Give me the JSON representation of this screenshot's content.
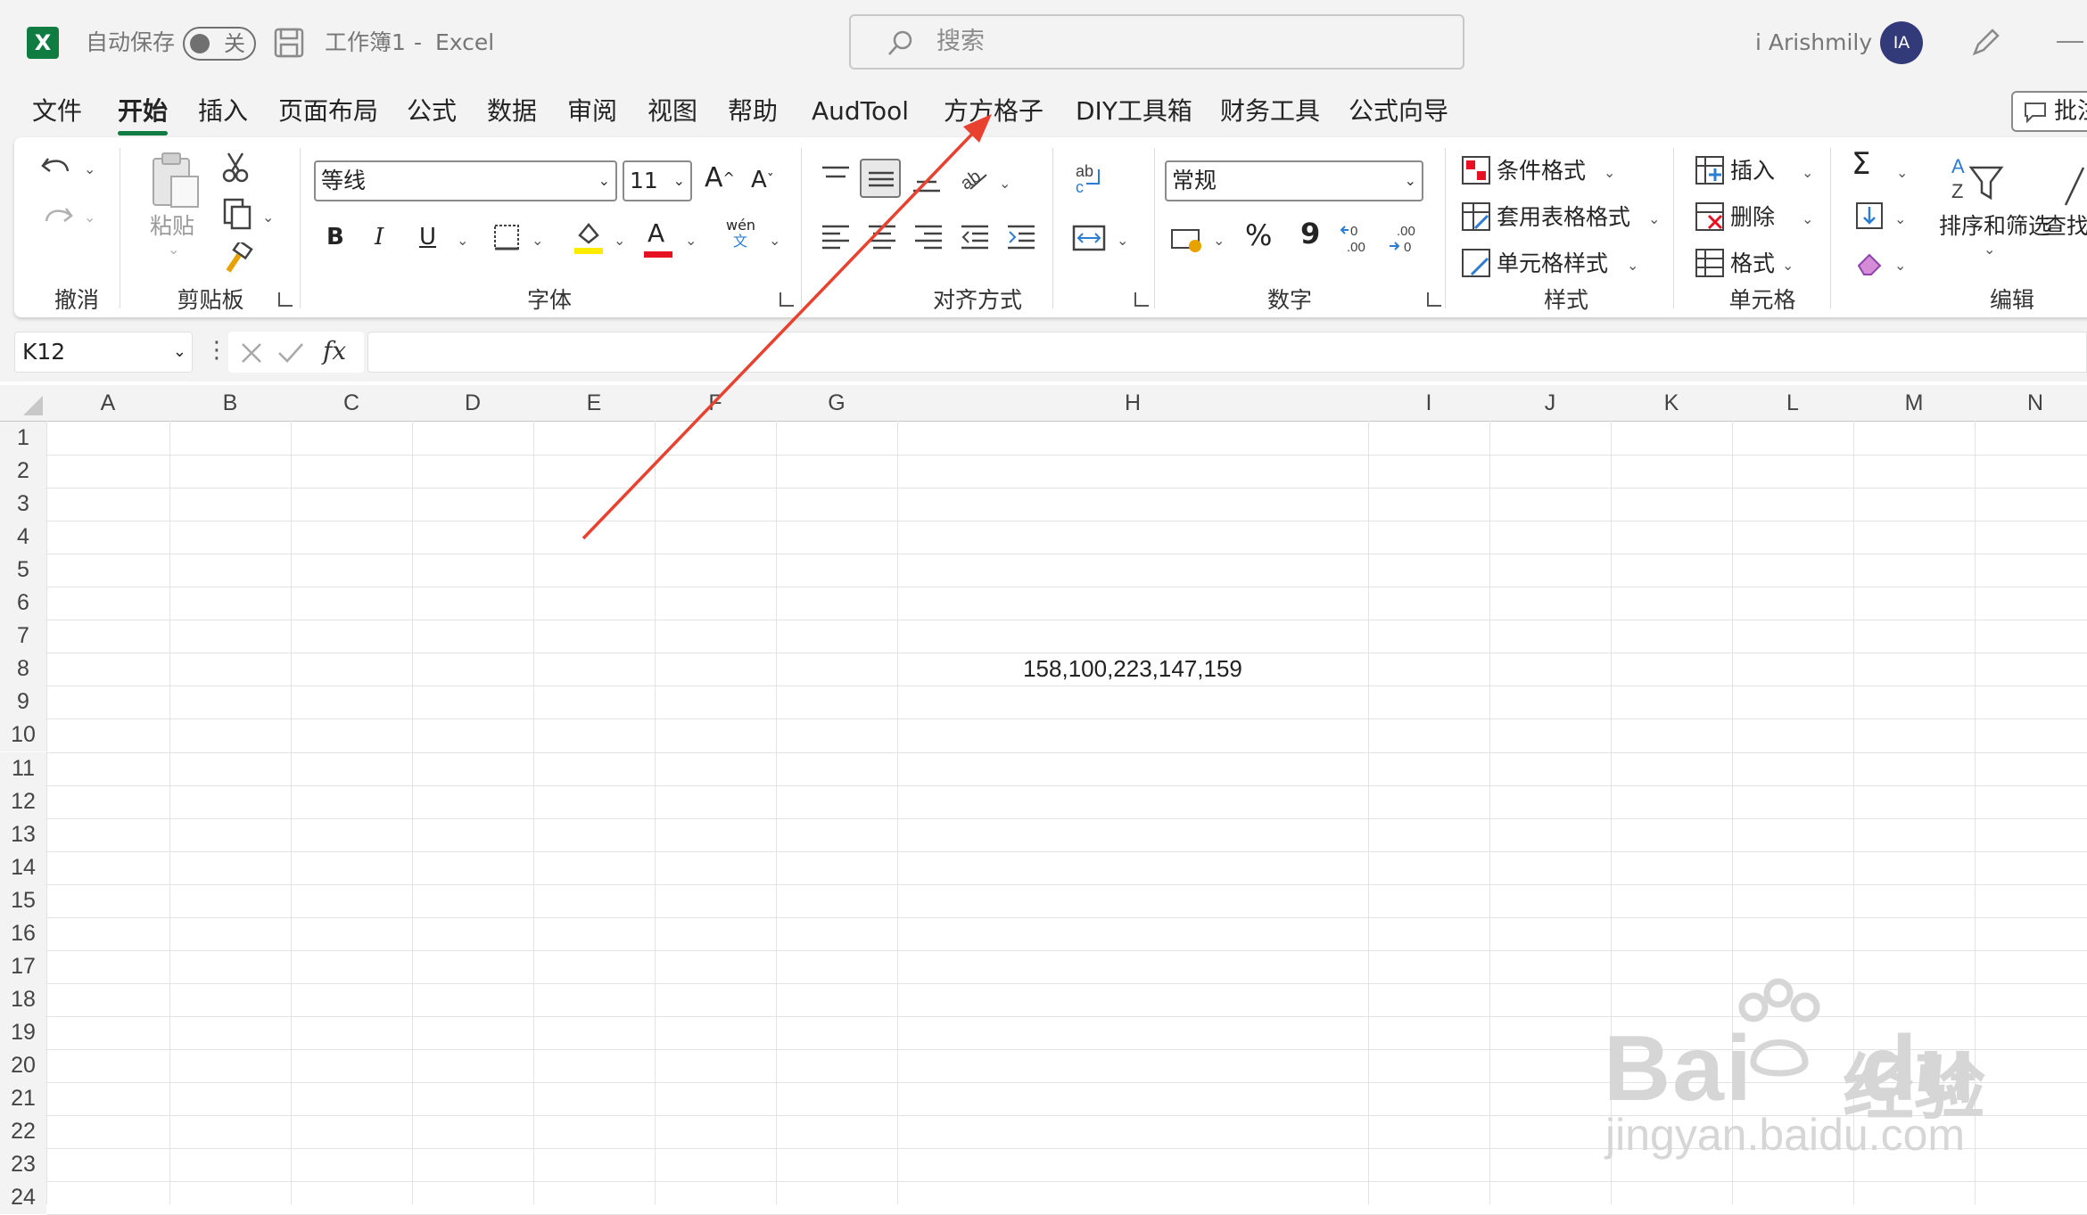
{
  "titlebar": {
    "app_icon": "excel-logo-icon",
    "autosave_label": "自动保存",
    "autosave_state": "关",
    "doc_title": "工作簿1",
    "title_sep": "-",
    "app_name": "Excel",
    "search_placeholder": "搜索",
    "user_name": "i Arishmily",
    "avatar_initials": "IA"
  },
  "tabs": [
    {
      "label": "文件"
    },
    {
      "label": "开始"
    },
    {
      "label": "插入"
    },
    {
      "label": "页面布局"
    },
    {
      "label": "公式"
    },
    {
      "label": "数据"
    },
    {
      "label": "审阅"
    },
    {
      "label": "视图"
    },
    {
      "label": "帮助"
    },
    {
      "label": "AudTool"
    },
    {
      "label": "方方格子"
    },
    {
      "label": "DIY工具箱"
    },
    {
      "label": "财务工具"
    },
    {
      "label": "公式向导"
    }
  ],
  "active_tab": "开始",
  "comment_button": "批注",
  "ribbon": {
    "undo_group": "撤消",
    "clipboard_group": "剪贴板",
    "paste_label": "粘贴",
    "font_group": "字体",
    "font_name": "等线",
    "font_size": "11",
    "bold": "B",
    "italic": "I",
    "underline": "U",
    "font_color_glyph": "A",
    "phonetic_glyph": "wén",
    "phonetic_sub": "文",
    "align_group": "对齐方式",
    "number_group": "数字",
    "number_format": "常规",
    "percent": "%",
    "comma": "9",
    "styles_group": "样式",
    "cond_format": "条件格式",
    "table_format": "套用表格格式",
    "cell_styles": "单元格样式",
    "cells_group": "单元格",
    "insert": "插入",
    "delete": "删除",
    "format": "格式",
    "edit_group": "编辑",
    "sort_filter": "排序和筛选",
    "find": "查找"
  },
  "formula_bar": {
    "name_box": "K12",
    "fx": "fx",
    "value": ""
  },
  "sheet": {
    "columns": [
      "A",
      "B",
      "C",
      "D",
      "E",
      "F",
      "G",
      "H",
      "I",
      "J",
      "K",
      "L",
      "M",
      "N"
    ],
    "rows": [
      "1",
      "2",
      "3",
      "4",
      "5",
      "6",
      "7",
      "8",
      "9",
      "10",
      "11",
      "12",
      "13",
      "14",
      "15",
      "16",
      "17",
      "18",
      "19",
      "20",
      "21",
      "22",
      "23",
      "24"
    ],
    "cell_H8": "158,100,223,147,159"
  },
  "annotation": {
    "color": "#e8412f"
  },
  "watermark": {
    "brand": "Bai",
    "brand2": "du",
    "cn": "经验",
    "url": "jingyan.baidu.com"
  }
}
